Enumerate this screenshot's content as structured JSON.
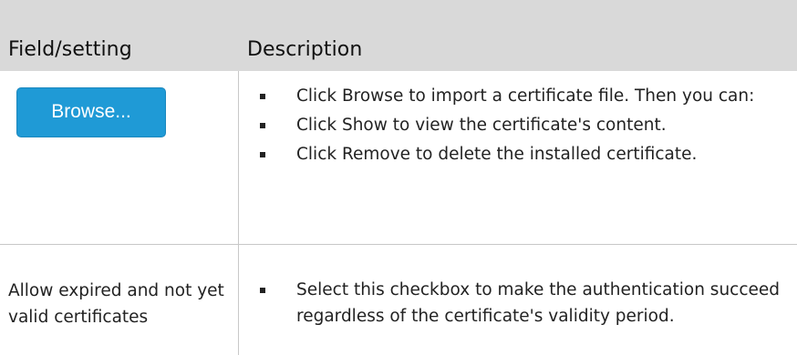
{
  "table": {
    "headers": {
      "field": "Field/setting",
      "description": "Description"
    },
    "rows": [
      {
        "field_button_label": "Browse...",
        "bullets": [
          "Click Browse to import a certificate file. Then you can:",
          "Click Show to view the certificate's content.",
          "Click Remove to delete the installed certificate."
        ]
      },
      {
        "field_text": "Allow expired and not yet valid certificates",
        "bullets": [
          "Select this checkbox to make the authentication succeed regardless of the certificate's validity period."
        ]
      }
    ]
  },
  "colors": {
    "header_background": "#d9d9d9",
    "button_background": "#1f9ad6",
    "button_text": "#ffffff",
    "grid_line": "#c8c8c8"
  }
}
